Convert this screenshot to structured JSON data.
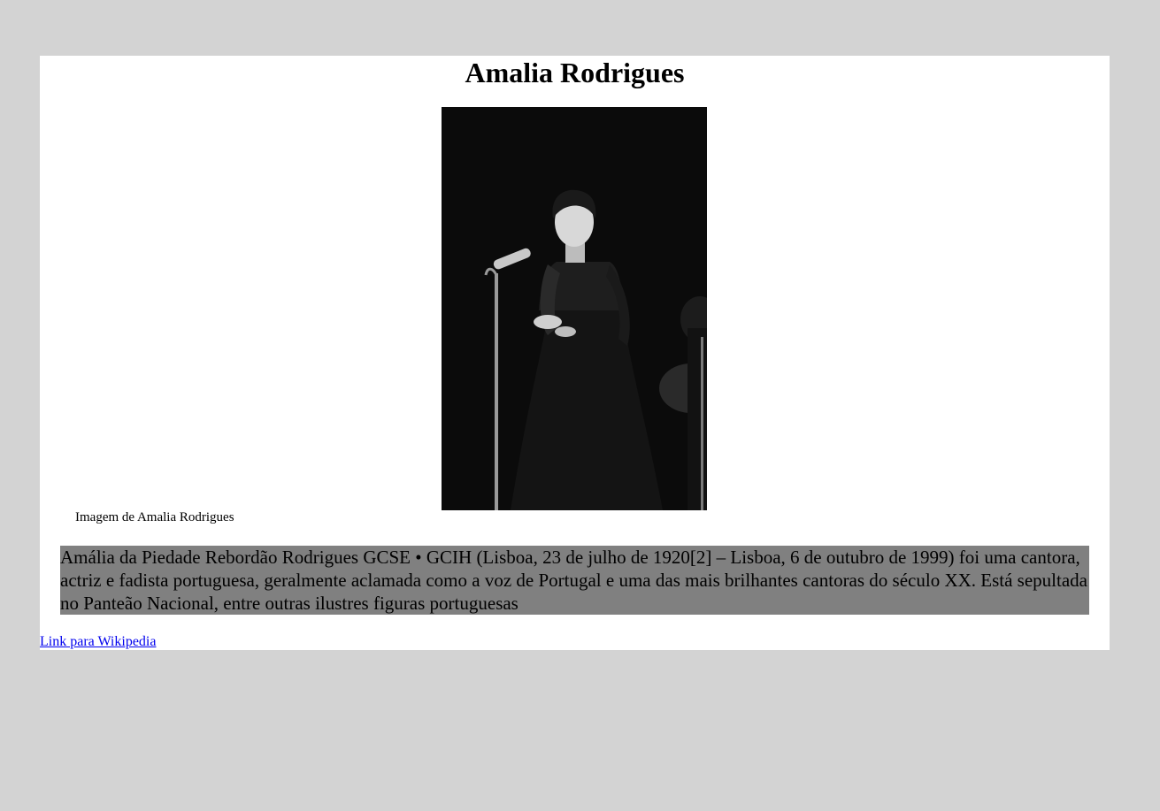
{
  "page": {
    "title": "Amalia Rodrigues",
    "image": {
      "subject": "black-and-white photo of a singer in a dark gown at a microphone on stage",
      "caption": "Imagem de Amalia Rodrigues"
    },
    "bio": "Amália da Piedade Rebordão Rodrigues GCSE • GCIH (Lisboa, 23 de julho de 1920[2] – Lisboa, 6 de outubro de 1999) foi uma cantora, actriz e fadista portuguesa, geralmente aclamada como a voz de Portugal e uma das mais brilhantes cantoras do século XX. Está sepultada no Panteão Nacional, entre outras ilustres figuras portuguesas",
    "link_label": "Link para Wikipedia"
  },
  "colors": {
    "background": "#d3d3d3",
    "content": "#ffffff",
    "bio_highlight": "#808080",
    "link": "#0000ee"
  }
}
